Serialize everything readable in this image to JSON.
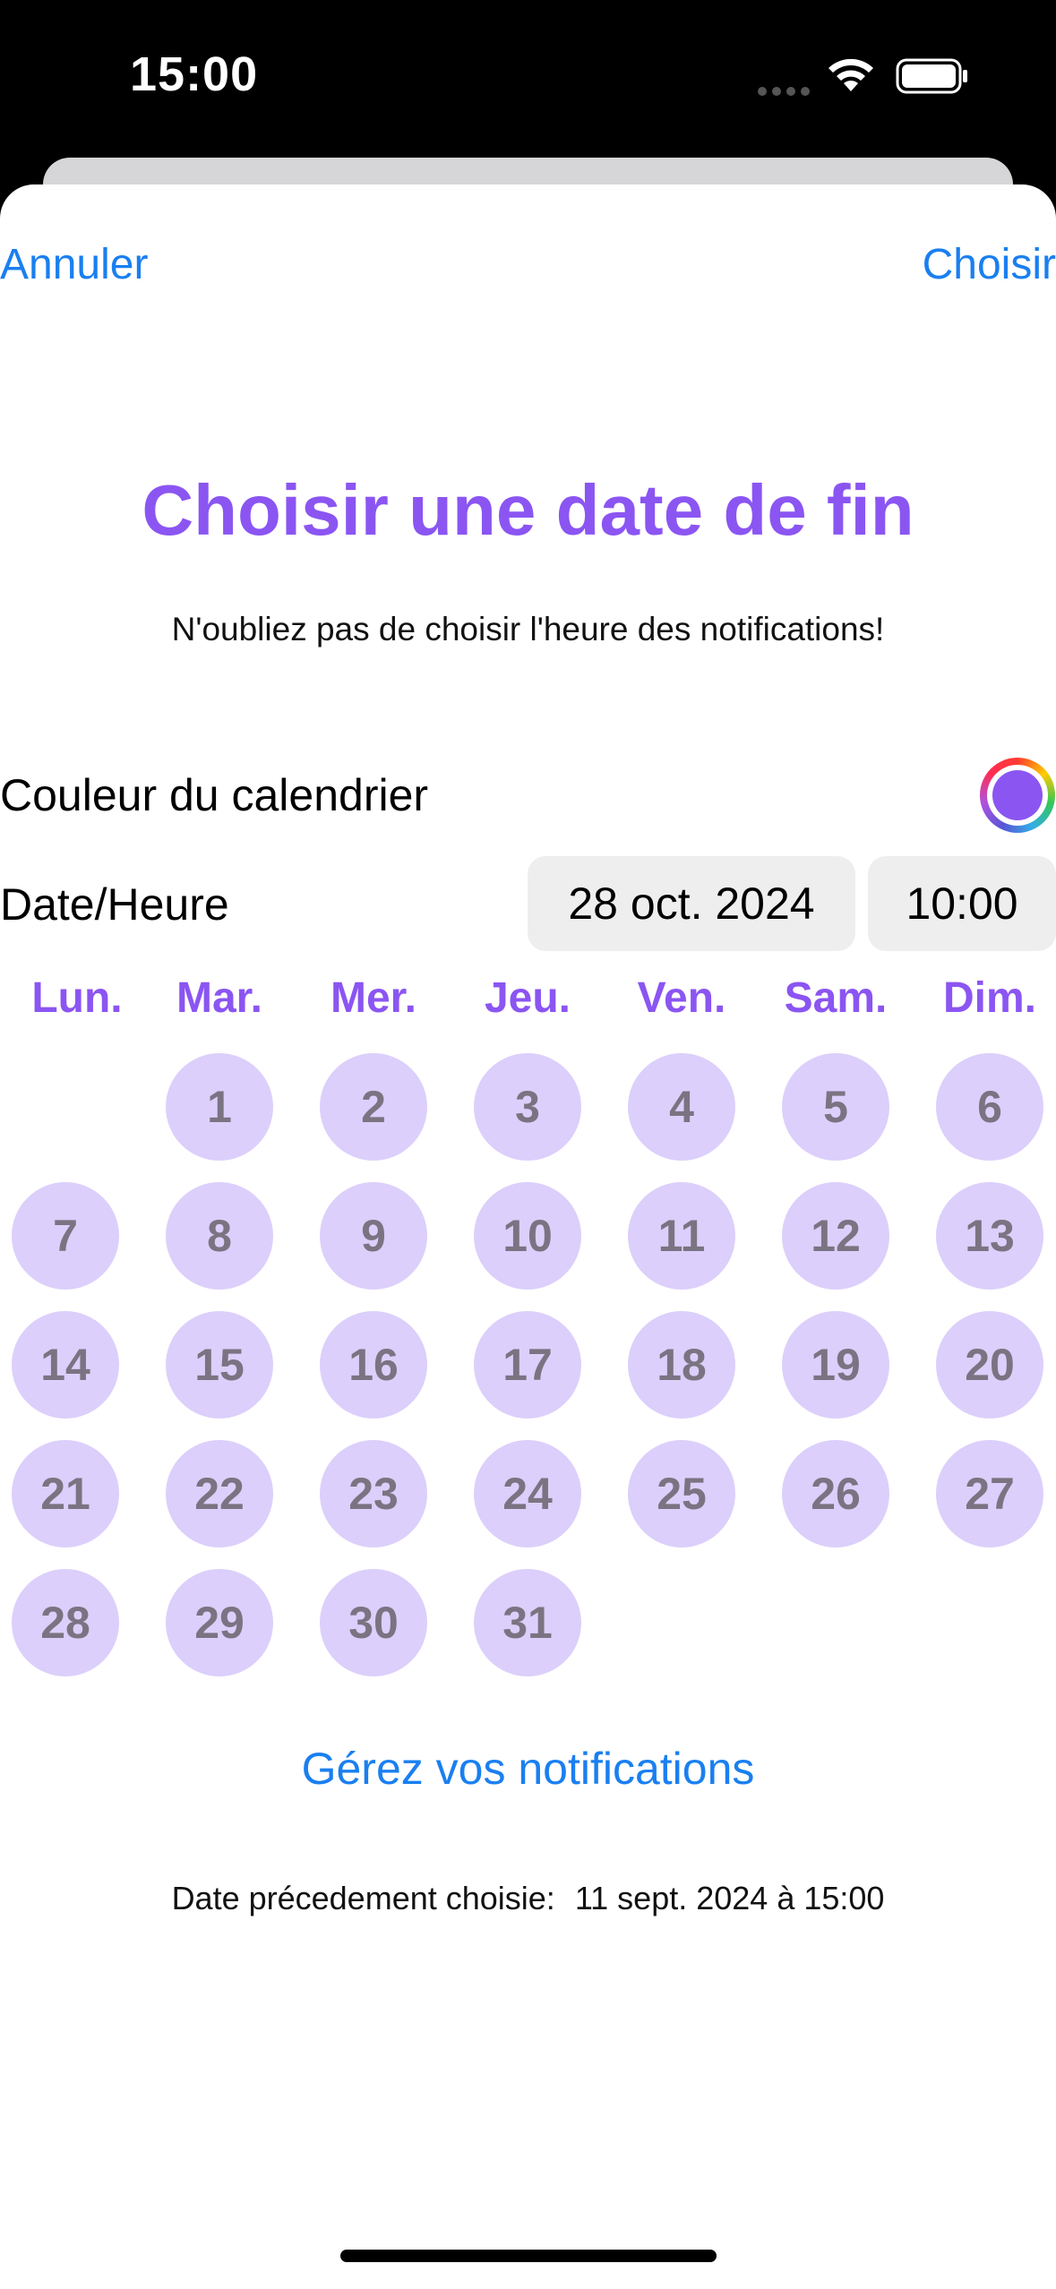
{
  "status_bar": {
    "time": "15:00"
  },
  "nav": {
    "cancel_label": "Annuler",
    "choose_label": "Choisir"
  },
  "header": {
    "title": "Choisir une date de fin",
    "subtitle": "N'oubliez pas de choisir l'heure des notifications!"
  },
  "form": {
    "color_label": "Couleur du calendrier",
    "selected_color": "#8b55f2",
    "datetime_label": "Date/Heure",
    "date_value": "28 oct. 2024",
    "time_value": "10:00"
  },
  "calendar": {
    "weekdays": [
      "Lun.",
      "Mar.",
      "Mer.",
      "Jeu.",
      "Ven.",
      "Sam.",
      "Dim."
    ],
    "days": [
      "1",
      "2",
      "3",
      "4",
      "5",
      "6",
      "7",
      "8",
      "9",
      "10",
      "11",
      "12",
      "13",
      "14",
      "15",
      "16",
      "17",
      "18",
      "19",
      "20",
      "21",
      "22",
      "23",
      "24",
      "25",
      "26",
      "27",
      "28",
      "29",
      "30",
      "31"
    ],
    "first_weekday_offset": 1,
    "accent_color": "#8b55f2",
    "day_fill_color": "#dccffb"
  },
  "footer": {
    "manage_notifications_label": "Gérez vos notifications",
    "previous_date_label": "Date précedement choisie:",
    "previous_date_value": "11 sept. 2024 à 15:00"
  }
}
